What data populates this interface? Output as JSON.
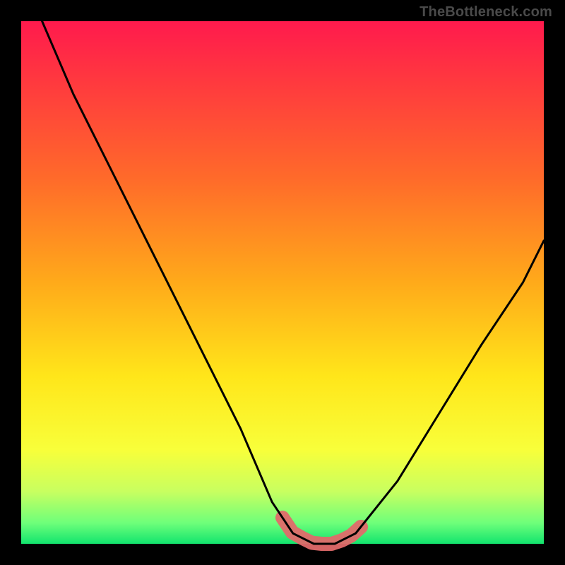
{
  "attribution": "TheBottleneck.com",
  "colors": {
    "frame": "#000000",
    "gradient_top": "#ff1a4d",
    "gradient_bottom": "#12e46e",
    "curve": "#000000",
    "highlight": "#e06a6a",
    "attribution_text": "#4a4a4a"
  },
  "chart_data": {
    "type": "line",
    "title": "",
    "xlabel": "",
    "ylabel": "",
    "xlim": [
      0,
      100
    ],
    "ylim": [
      0,
      100
    ],
    "grid": false,
    "legend": false,
    "background": "vertical-heatmap-gradient",
    "series": [
      {
        "name": "bottleneck-curve",
        "x": [
          4,
          10,
          18,
          26,
          34,
          42,
          48,
          52,
          56,
          60,
          64,
          72,
          80,
          88,
          96,
          100
        ],
        "values": [
          100,
          86,
          70,
          54,
          38,
          22,
          8,
          2,
          0,
          0,
          2,
          12,
          25,
          38,
          50,
          58
        ]
      }
    ],
    "highlight_range": {
      "x_start": 50,
      "x_end": 65,
      "note": "near-minimum flat section emphasized with thick pink stroke"
    }
  }
}
